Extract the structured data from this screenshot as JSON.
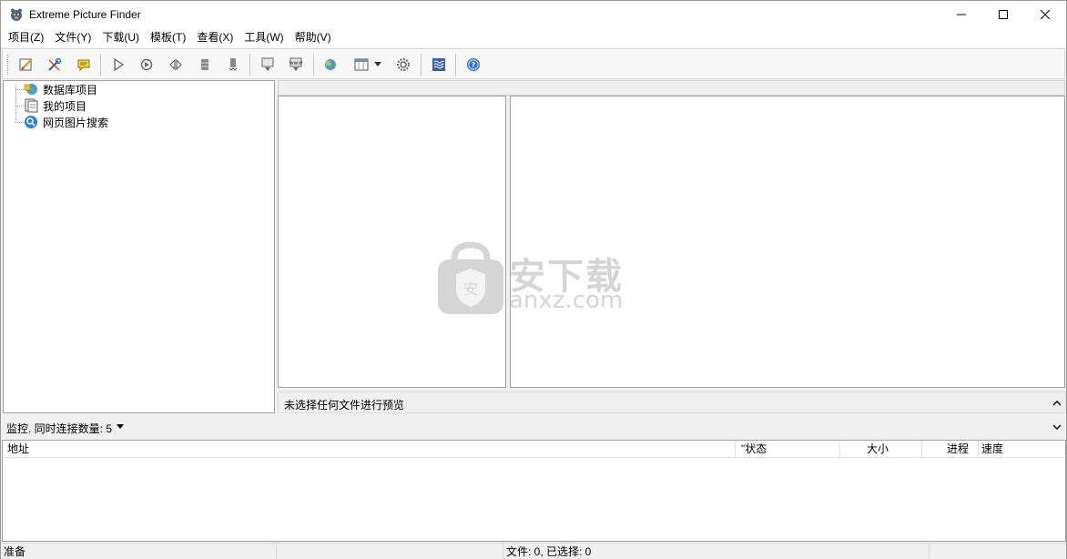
{
  "window": {
    "title": "Extreme Picture Finder"
  },
  "menu": {
    "items": [
      {
        "label": "项目(Z)"
      },
      {
        "label": "文件(Y)"
      },
      {
        "label": "下载(U)"
      },
      {
        "label": "模板(T)"
      },
      {
        "label": "查看(X)"
      },
      {
        "label": "工具(W)"
      },
      {
        "label": "帮助(V)"
      }
    ]
  },
  "toolbar": {
    "icons": [
      "edit-project-icon",
      "project-settings-icon",
      "comment-icon",
      "start-icon",
      "refresh-icon",
      "resume-icon",
      "stop-icon",
      "queue-icon",
      "download-page-icon",
      "download-all-icon",
      "web-search-icon",
      "view-mode-icon",
      "settings-gear-icon",
      "log-icon",
      "help-icon"
    ]
  },
  "tree": {
    "nodes": [
      {
        "label": "数据库项目",
        "icon": "database-globe-icon"
      },
      {
        "label": "我的项目",
        "icon": "my-projects-icon"
      },
      {
        "label": "网页图片搜索",
        "icon": "web-image-search-icon"
      }
    ]
  },
  "preview": {
    "status_text": "未选择任何文件进行预览"
  },
  "monitor": {
    "text": "监控. 同时连接数量: 5"
  },
  "download_list": {
    "columns": [
      {
        "label": "地址"
      },
      {
        "label": "\"状态"
      },
      {
        "label": "大小"
      },
      {
        "label": "进程"
      },
      {
        "label": "速度"
      }
    ],
    "rows": []
  },
  "statusbar": {
    "ready": "准备",
    "pane2": "",
    "files": "文件: 0, 已选择: 0",
    "pane4": ""
  },
  "watermark": {
    "cn": "安下载",
    "en": "anxz.com",
    "shield_char": "安"
  },
  "colors": {
    "accent_blue": "#2a6fd6",
    "panel_border": "#a0a0a0",
    "watermark_gray": "#c8c8c8"
  }
}
